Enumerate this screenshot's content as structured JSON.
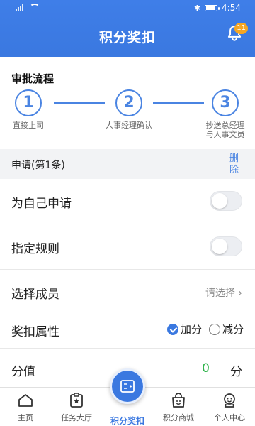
{
  "status_bar": {
    "time": "4:54"
  },
  "header": {
    "title": "积分奖扣",
    "notification_count": "11"
  },
  "approval": {
    "title": "审批流程",
    "steps": [
      {
        "number": "1",
        "label": "直接上司"
      },
      {
        "number": "2",
        "label": "人事经理确认"
      },
      {
        "number": "3",
        "label_line1": "抄送总经理",
        "label_line2": "与人事文员"
      }
    ]
  },
  "application": {
    "label": "申请(第1条)",
    "delete_label": "删除"
  },
  "form": {
    "self_apply": {
      "label": "为自己申请",
      "enabled": false
    },
    "assign_rule": {
      "label": "指定规则",
      "enabled": false
    },
    "select_member": {
      "label": "选择成员",
      "placeholder": "请选择 ›"
    },
    "reward_type": {
      "label": "奖扣属性",
      "options": [
        "加分",
        "减分"
      ],
      "selected": "加分"
    },
    "score": {
      "label": "分值",
      "value": "0",
      "unit": "分"
    }
  },
  "tabbar": {
    "items": [
      {
        "label": "主页",
        "icon": "home-icon"
      },
      {
        "label": "任务大厅",
        "icon": "task-icon"
      },
      {
        "label": "积分奖扣",
        "icon": "points-icon",
        "active": true
      },
      {
        "label": "积分商城",
        "icon": "shop-icon"
      },
      {
        "label": "个人中心",
        "icon": "profile-icon"
      }
    ]
  },
  "colors": {
    "primary": "#3a78e0",
    "score_green": "#2db34a",
    "badge": "#f5a623"
  }
}
